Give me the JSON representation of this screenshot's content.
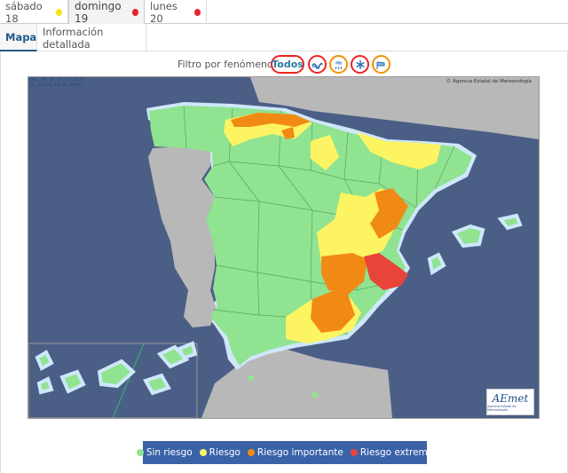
{
  "days": [
    {
      "label": "sábado 18",
      "status_color": "#f2e51f"
    },
    {
      "label": "domingo 19",
      "status_color": "#e7242b"
    },
    {
      "label": "lunes 20",
      "status_color": "#e7242b"
    }
  ],
  "views": [
    {
      "label": "Mapa",
      "active": true
    },
    {
      "label": "Información detallada",
      "active": false
    }
  ],
  "filter": {
    "label": "Filtro por fenómenos:",
    "buttons": [
      {
        "label": "Todos",
        "icon": "all",
        "color": "#e7242b"
      },
      {
        "label": "",
        "icon": "coastal-waves-icon",
        "color": "#e7242b"
      },
      {
        "label": "",
        "icon": "rain-icon",
        "color": "#f39200"
      },
      {
        "label": "",
        "icon": "snow-icon",
        "color": "#e7242b"
      },
      {
        "label": "",
        "icon": "wind-icon",
        "color": "#f39200"
      }
    ]
  },
  "map": {
    "stamp_line1": "Dal 00:00 19-01-2020",
    "stamp_line2": "Al 23:59 19-01-2020",
    "credit": "© Agencia Estatal de Meteorología",
    "logo_text": "AEmet",
    "logo_subtitle": "Agencia Estatal de Meteorología",
    "colors": {
      "sea": "#4b5f86",
      "foreign": "#b8b8b8",
      "green": "#8fe391",
      "yellow": "#fdf463",
      "orange": "#f08a14",
      "red": "#e8443a",
      "coast": "#cfe7fb"
    }
  },
  "legend": [
    {
      "label": "Sin riesgo",
      "color": "#8fe391"
    },
    {
      "label": "Riesgo",
      "color": "#fdf463"
    },
    {
      "label": "Riesgo importante",
      "color": "#f08a14"
    },
    {
      "label": "Riesgo extremo",
      "color": "#e8443a"
    }
  ]
}
